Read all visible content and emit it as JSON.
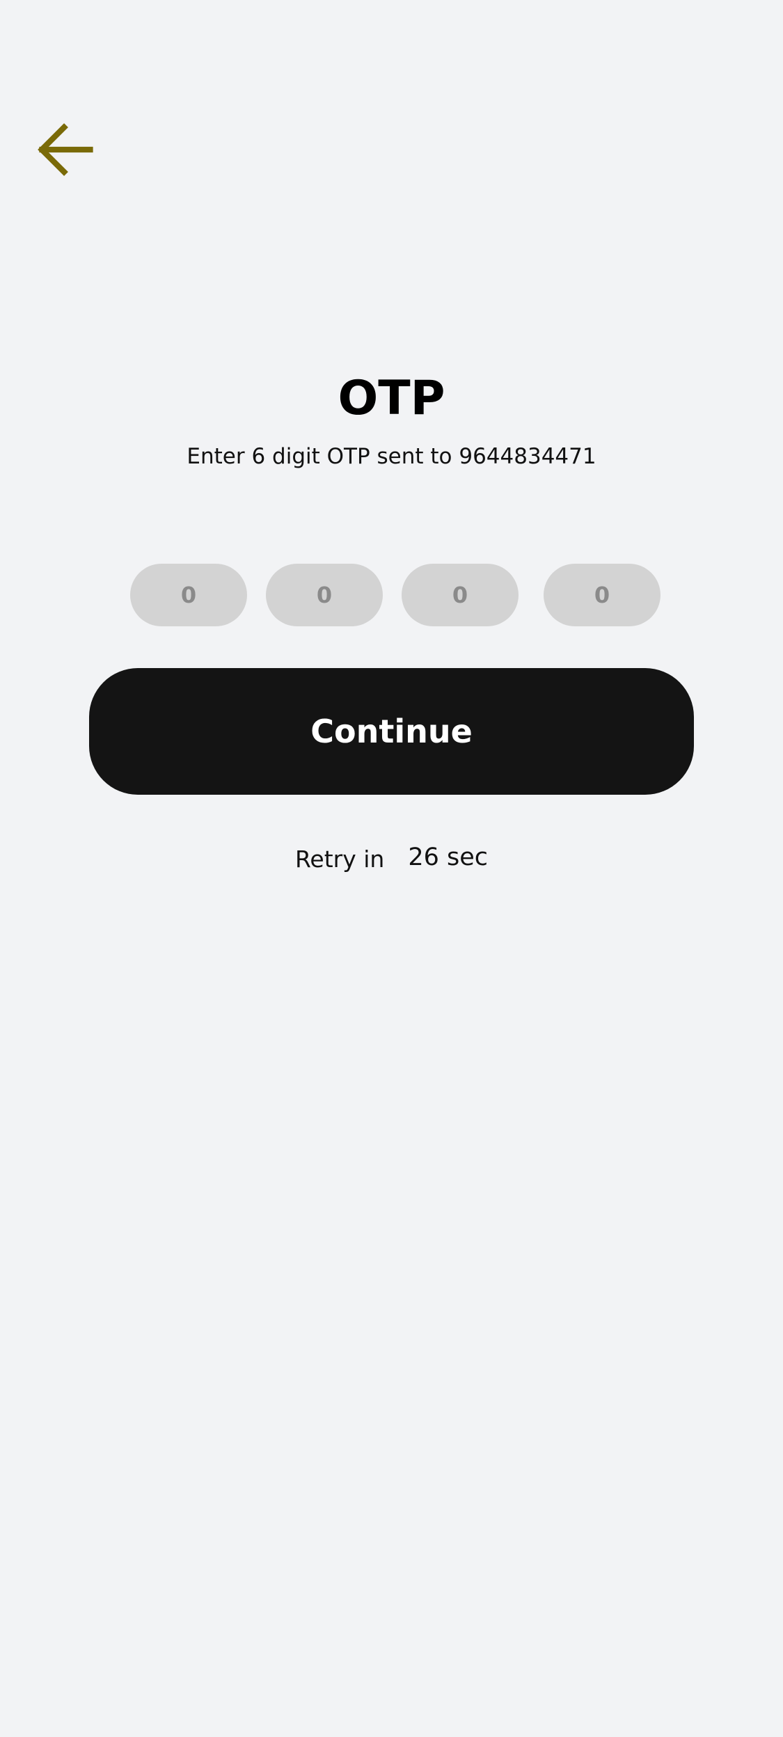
{
  "header": {
    "back_icon": "arrow-left-icon",
    "accent_color": "#7a6a08"
  },
  "main": {
    "title": "OTP",
    "subtitle": "Enter 6 digit OTP sent to 9644834471",
    "otp_boxes": [
      {
        "placeholder": "0",
        "value": ""
      },
      {
        "placeholder": "0",
        "value": ""
      },
      {
        "placeholder": "0",
        "value": ""
      },
      {
        "placeholder": "0",
        "value": ""
      }
    ],
    "continue_label": "Continue",
    "retry_label": "Retry in",
    "retry_countdown": "26 sec"
  },
  "colors": {
    "background": "#f2f3f5",
    "otp_box": "#d3d3d3",
    "button": "#141414",
    "button_text": "#ffffff"
  }
}
